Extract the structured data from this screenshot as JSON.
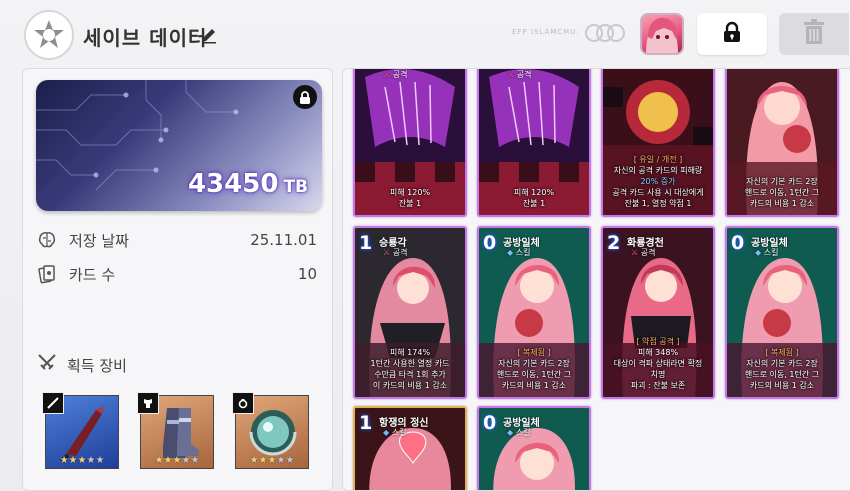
{
  "header": {
    "title": "세이브 데이터",
    "brand_text": "EFP ISLAMCMU.",
    "colors": {
      "accent": "#c778e6",
      "text": "#333333"
    }
  },
  "summary": {
    "banner_value": "43450",
    "banner_unit": "TB",
    "save_date_label": "저장 날짜",
    "save_date_value": "25.11.01",
    "card_count_label": "카드 수",
    "card_count_value": "10",
    "equipment_label": "획득 장비"
  },
  "equipment": [
    {
      "slot": "weapon-icon",
      "stars_on": 3,
      "stars_off": 2,
      "color": "#2f5bb8"
    },
    {
      "slot": "armor-icon",
      "stars_on": 3,
      "stars_off": 2,
      "color": "#c98554"
    },
    {
      "slot": "ring-icon",
      "stars_on": 3,
      "stars_off": 2,
      "color": "#c98554"
    }
  ],
  "cards": [
    {
      "cost": "",
      "name": "",
      "ctype": "공격",
      "type_icon": "attack",
      "tagline": "",
      "lines": [
        "피해 120%",
        "잔불 1"
      ]
    },
    {
      "cost": "",
      "name": "",
      "ctype": "공격",
      "type_icon": "attack",
      "tagline": "",
      "lines": [
        "피해 120%",
        "잔불 1"
      ]
    },
    {
      "cost": "",
      "name": "",
      "ctype": "",
      "type_icon": "attack",
      "tagline": "[ 유일 / 개전 ]",
      "lines": [
        "자신의 공격 카드의 피해량",
        "20% 증가",
        "공격 카드 사용 시 대상에게",
        "잔불 1, 열정 약점 1"
      ]
    },
    {
      "cost": "",
      "name": "",
      "ctype": "",
      "type_icon": "skill",
      "tagline": "",
      "lines": [
        "자신의 기본 카드 2장",
        "핸드로 이동, 1턴간 그",
        "카드의 비용 1 감소"
      ]
    },
    {
      "cost": "1",
      "name": "승룡각",
      "ctype": "공격",
      "type_icon": "attack",
      "tagline": "",
      "lines": [
        "피해 174%",
        "1턴간 사용한 열정 카드",
        "수만큼 타격 1회 추가",
        "이 카드의 비용 1 감소"
      ]
    },
    {
      "cost": "0",
      "name": "공방일체",
      "ctype": "스킬",
      "type_icon": "skill",
      "tagline": "[ 복제됨 ]",
      "lines": [
        "자신의 기본 카드 2장",
        "핸드로 이동, 1턴간 그",
        "카드의 비용 1 감소"
      ]
    },
    {
      "cost": "2",
      "name": "화룡경천",
      "ctype": "공격",
      "type_icon": "attack",
      "tagline": "[ 약점 공격 ]",
      "lines": [
        "피해 348%",
        "대상이 격파 상태라면 확정",
        "치명",
        "파괴 : 잔불 보존"
      ]
    },
    {
      "cost": "0",
      "name": "공방일체",
      "ctype": "스킬",
      "type_icon": "skill",
      "tagline": "[ 복제됨 ]",
      "lines": [
        "자신의 기본 카드 2장",
        "핸드로 이동, 1턴간 그",
        "카드의 비용 1 감소"
      ]
    },
    {
      "cost": "1",
      "name": "항쟁의 정신",
      "ctype": "스킬",
      "type_icon": "skill",
      "tagline": "",
      "lines": []
    },
    {
      "cost": "0",
      "name": "공방일체",
      "ctype": "스킬",
      "type_icon": "skill",
      "tagline": "",
      "lines": []
    }
  ]
}
